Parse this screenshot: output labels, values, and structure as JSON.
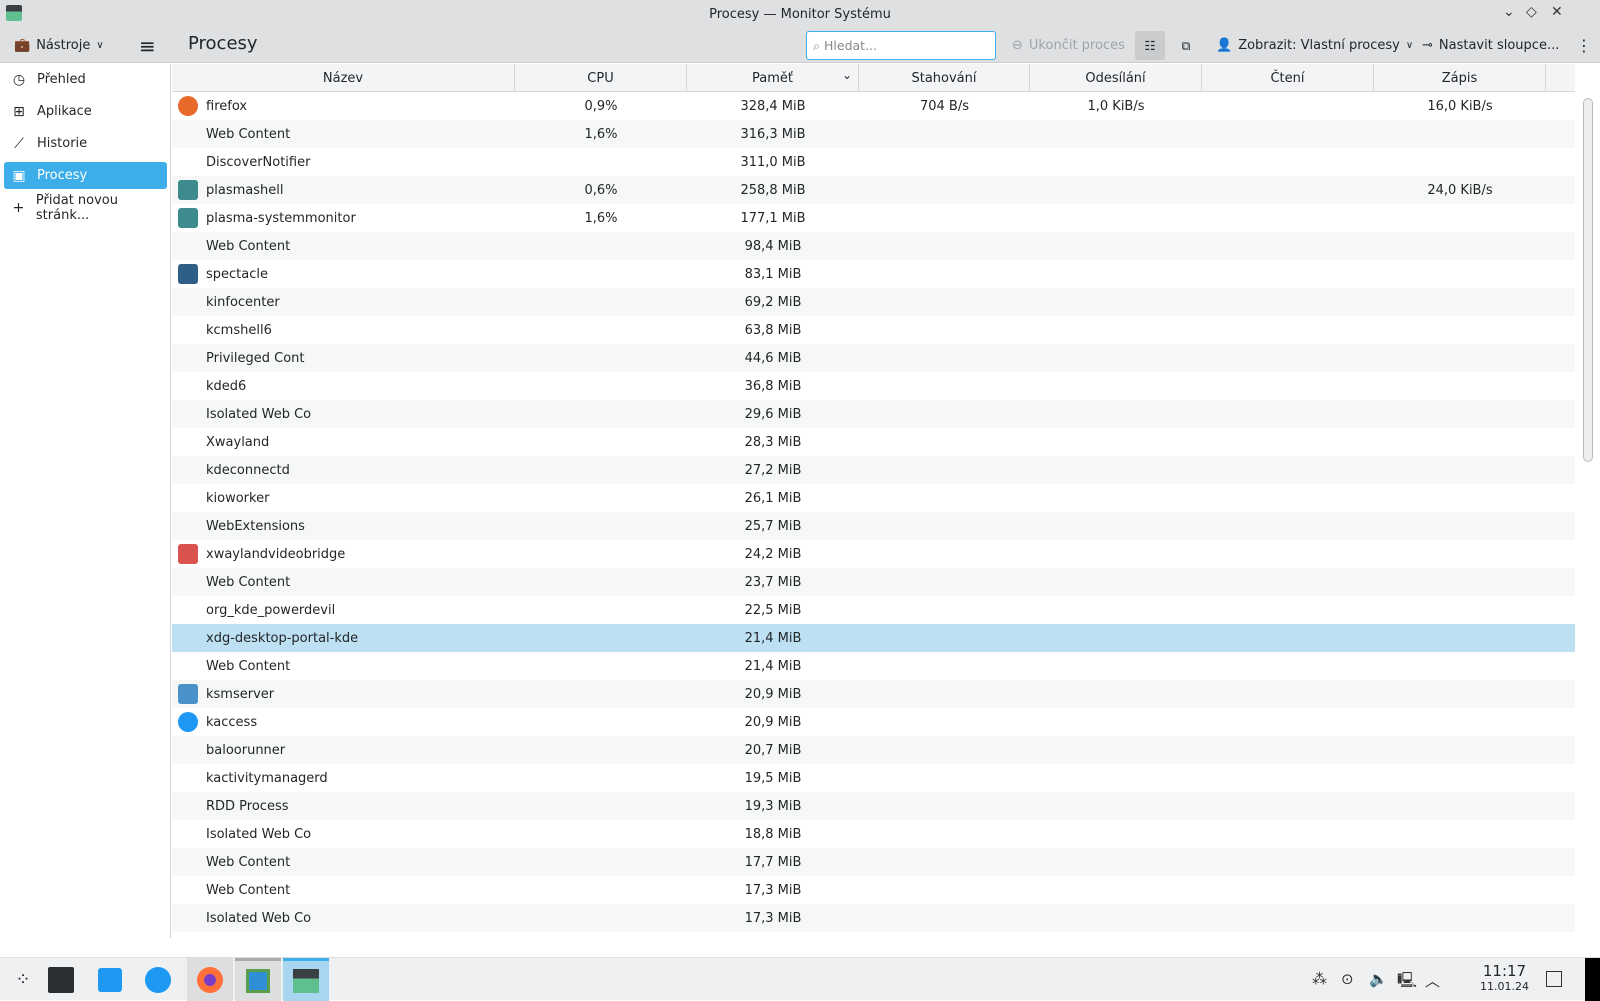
{
  "window": {
    "title": "Procesy — Monitor Systému"
  },
  "toolbar": {
    "tools": "Nástroje",
    "page_title": "Procesy",
    "search_placeholder": "Hledat...",
    "kill": "Ukončit proces",
    "show": "Zobrazit: Vlastní procesy",
    "columns": "Nastavit sloupce..."
  },
  "sidebar": {
    "items": [
      {
        "label": "Přehled",
        "icon": "gauge"
      },
      {
        "label": "Aplikace",
        "icon": "grid"
      },
      {
        "label": "Historie",
        "icon": "chart"
      },
      {
        "label": "Procesy",
        "icon": "process"
      },
      {
        "label": "Přidat novou stránk...",
        "icon": "plus"
      }
    ]
  },
  "columns": [
    "Název",
    "CPU",
    "Paměť",
    "Stahování",
    "Odesílání",
    "Čtení",
    "Zápis"
  ],
  "rows": [
    [
      "firefox",
      "0,9%",
      "328,4 MiB",
      "704 B/s",
      "1,0 KiB/s",
      "",
      "16,0 KiB/s"
    ],
    [
      "Web Content",
      "1,6%",
      "316,3 MiB",
      "",
      "",
      "",
      ""
    ],
    [
      "DiscoverNotifier",
      "",
      "311,0 MiB",
      "",
      "",
      "",
      ""
    ],
    [
      "plasmashell",
      "0,6%",
      "258,8 MiB",
      "",
      "",
      "",
      "24,0 KiB/s"
    ],
    [
      "plasma-systemmonitor",
      "1,6%",
      "177,1 MiB",
      "",
      "",
      "",
      ""
    ],
    [
      "Web Content",
      "",
      "98,4 MiB",
      "",
      "",
      "",
      ""
    ],
    [
      "spectacle",
      "",
      "83,1 MiB",
      "",
      "",
      "",
      ""
    ],
    [
      "kinfocenter",
      "",
      "69,2 MiB",
      "",
      "",
      "",
      ""
    ],
    [
      "kcmshell6",
      "",
      "63,8 MiB",
      "",
      "",
      "",
      ""
    ],
    [
      "Privileged Cont",
      "",
      "44,6 MiB",
      "",
      "",
      "",
      ""
    ],
    [
      "kded6",
      "",
      "36,8 MiB",
      "",
      "",
      "",
      ""
    ],
    [
      "Isolated Web Co",
      "",
      "29,6 MiB",
      "",
      "",
      "",
      ""
    ],
    [
      "Xwayland",
      "",
      "28,3 MiB",
      "",
      "",
      "",
      ""
    ],
    [
      "kdeconnectd",
      "",
      "27,2 MiB",
      "",
      "",
      "",
      ""
    ],
    [
      "kioworker",
      "",
      "26,1 MiB",
      "",
      "",
      "",
      ""
    ],
    [
      "WebExtensions",
      "",
      "25,7 MiB",
      "",
      "",
      "",
      ""
    ],
    [
      "xwaylandvideobridge",
      "",
      "24,2 MiB",
      "",
      "",
      "",
      ""
    ],
    [
      "Web Content",
      "",
      "23,7 MiB",
      "",
      "",
      "",
      ""
    ],
    [
      "org_kde_powerdevil",
      "",
      "22,5 MiB",
      "",
      "",
      "",
      ""
    ],
    [
      "xdg-desktop-portal-kde",
      "",
      "21,4 MiB",
      "",
      "",
      "",
      ""
    ],
    [
      "Web Content",
      "",
      "21,4 MiB",
      "",
      "",
      "",
      ""
    ],
    [
      "ksmserver",
      "",
      "20,9 MiB",
      "",
      "",
      "",
      ""
    ],
    [
      "kaccess",
      "",
      "20,9 MiB",
      "",
      "",
      "",
      ""
    ],
    [
      "baloorunner",
      "",
      "20,7 MiB",
      "",
      "",
      "",
      ""
    ],
    [
      "kactivitymanagerd",
      "",
      "19,5 MiB",
      "",
      "",
      "",
      ""
    ],
    [
      "RDD Process",
      "",
      "19,3 MiB",
      "",
      "",
      "",
      ""
    ],
    [
      "Isolated Web Co",
      "",
      "18,8 MiB",
      "",
      "",
      "",
      ""
    ],
    [
      "Web Content",
      "",
      "17,7 MiB",
      "",
      "",
      "",
      ""
    ],
    [
      "Web Content",
      "",
      "17,3 MiB",
      "",
      "",
      "",
      ""
    ],
    [
      "Isolated Web Co",
      "",
      "17,3 MiB",
      "",
      "",
      "",
      ""
    ]
  ],
  "row_icons": {
    "0": "#e8692a",
    "3": "#3d8a8f",
    "4": "#3d8a8f",
    "6": "#2f5f86",
    "16": "#d9534f",
    "21": "#4a90c9",
    "22": "#1d99f3"
  },
  "selected_row": 19,
  "taskbar": {
    "time": "11:17",
    "date": "11.01.24"
  }
}
